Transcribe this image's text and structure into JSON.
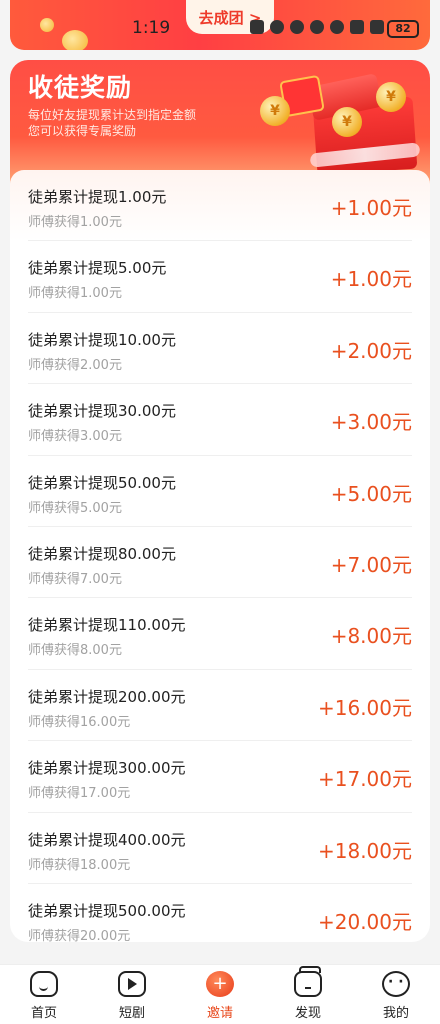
{
  "top_banner": {
    "button_label": "去成团 >"
  },
  "status_bar": {
    "time": "1:19",
    "battery": "82"
  },
  "reward_card": {
    "title": "收徒奖励",
    "subtitle_line1": "每位好友提现累计达到指定金额",
    "subtitle_line2": "您可以获得专属奖励",
    "rows": [
      {
        "condition": "徒弟累计提现1.00元",
        "reward_text": "师傅获得1.00元",
        "amount": "+1.00元"
      },
      {
        "condition": "徒弟累计提现5.00元",
        "reward_text": "师傅获得1.00元",
        "amount": "+1.00元"
      },
      {
        "condition": "徒弟累计提现10.00元",
        "reward_text": "师傅获得2.00元",
        "amount": "+2.00元"
      },
      {
        "condition": "徒弟累计提现30.00元",
        "reward_text": "师傅获得3.00元",
        "amount": "+3.00元"
      },
      {
        "condition": "徒弟累计提现50.00元",
        "reward_text": "师傅获得5.00元",
        "amount": "+5.00元"
      },
      {
        "condition": "徒弟累计提现80.00元",
        "reward_text": "师傅获得7.00元",
        "amount": "+7.00元"
      },
      {
        "condition": "徒弟累计提现110.00元",
        "reward_text": "师傅获得8.00元",
        "amount": "+8.00元"
      },
      {
        "condition": "徒弟累计提现200.00元",
        "reward_text": "师傅获得16.00元",
        "amount": "+16.00元"
      },
      {
        "condition": "徒弟累计提现300.00元",
        "reward_text": "师傅获得17.00元",
        "amount": "+17.00元"
      },
      {
        "condition": "徒弟累计提现400.00元",
        "reward_text": "师傅获得18.00元",
        "amount": "+18.00元"
      },
      {
        "condition": "徒弟累计提现500.00元",
        "reward_text": "师傅获得20.00元",
        "amount": "+20.00元"
      }
    ]
  },
  "bottom_nav": {
    "items": [
      {
        "label": "首页",
        "icon": "home-icon"
      },
      {
        "label": "短剧",
        "icon": "play-tv-icon"
      },
      {
        "label": "邀请",
        "icon": "invite-icon"
      },
      {
        "label": "发现",
        "icon": "discover-icon"
      },
      {
        "label": "我的",
        "icon": "profile-icon"
      }
    ],
    "active_index": 2,
    "active_color": "#e8491d"
  },
  "colors": {
    "accent": "#e9501f",
    "header_red": "#ff4e45"
  }
}
